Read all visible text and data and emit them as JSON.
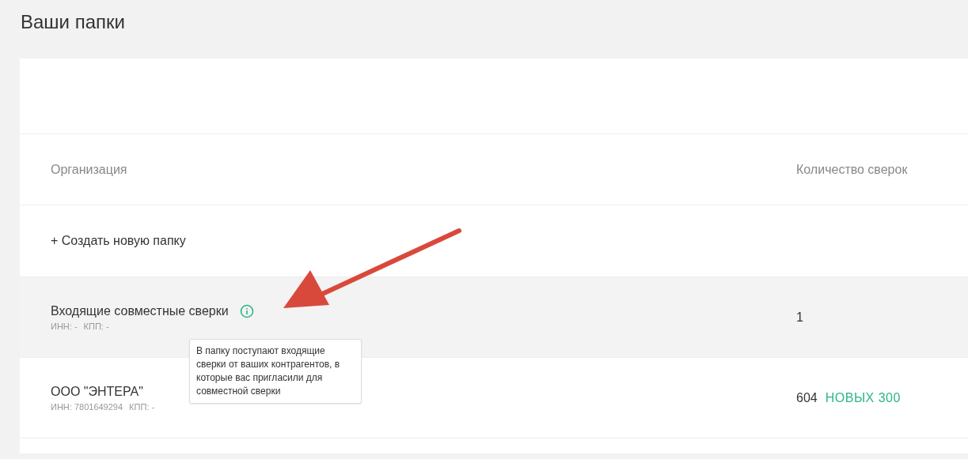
{
  "page_title": "Ваши папки",
  "table": {
    "columns": [
      "Организация",
      "Количество сверок"
    ],
    "create_link": "+ Создать новую папку",
    "rows": [
      {
        "name": "Входящие совместные сверки",
        "inn": "ИНН: -",
        "kpp": "КПП: -",
        "count": "1",
        "highlighted": true,
        "info": true,
        "tooltip": "В папку поступают входящие сверки от ваших контрагентов, в которые вас пригласили для совместной сверки"
      },
      {
        "name": "ООО \"ЭНТЕРА\"",
        "inn": "ИНН: 7801649294",
        "kpp": "КПП: -",
        "count": "604",
        "new_label": "НОВЫХ 300",
        "highlighted": false,
        "info": false
      }
    ]
  }
}
